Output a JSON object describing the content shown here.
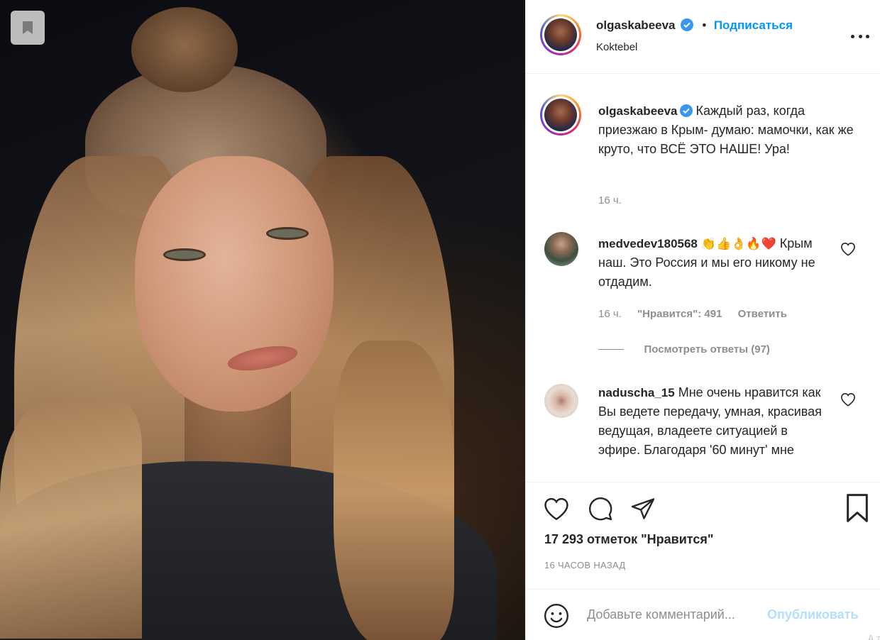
{
  "post": {
    "username": "olgaskabeeva",
    "follow_label": "Подписаться",
    "location": "Koktebel",
    "more_label": "•••"
  },
  "caption": {
    "username": "olgaskabeeva",
    "text": "Каждый раз, когда приезжаю в Крым- думаю: мамочки, как же круто, что ВСЁ ЭТО НАШЕ! Ура!",
    "time": "16 ч."
  },
  "comments": [
    {
      "username": "medvedev180568",
      "emoji": "👏👍👌🔥❤️",
      "text": "Крым наш. Это Россия и мы его никому не отдадим.",
      "time": "16 ч.",
      "likes": "\"Нравится\": 491",
      "reply_label": "Ответить",
      "view_replies": "Посмотреть ответы (97)"
    },
    {
      "username": "naduscha_15",
      "text": "Мне очень нравится как Вы ведете передачу, умная, красивая ведущая, владеете ситуацией в эфире. Благодаря '60 минут' мне"
    }
  ],
  "actions": {
    "likes": "17 293 отметок \"Нравится\"",
    "time_ago": "16 ЧАСОВ НАЗАД",
    "comment_placeholder": "Добавьте комментарий...",
    "publish_label": "Опубликовать",
    "corner_text": "А т"
  },
  "icons": [
    "bookmark-icon",
    "verified-icon",
    "more-icon",
    "heart-icon",
    "comment-icon",
    "share-icon",
    "save-icon",
    "emoji-icon"
  ],
  "colors": {
    "accent": "#0095f6",
    "publish_disabled": "#b2dffc",
    "text": "#262626",
    "muted": "#8e8e8e"
  }
}
